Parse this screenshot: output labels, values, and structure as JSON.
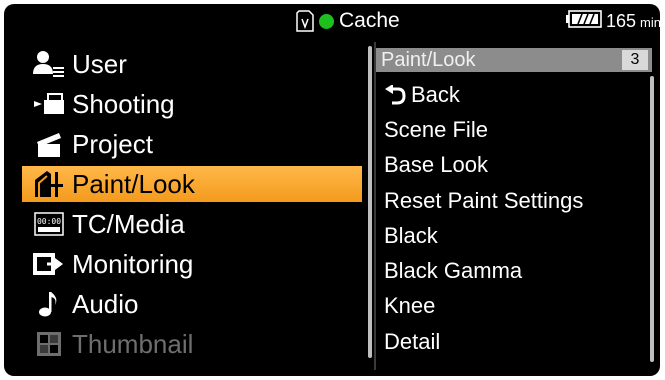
{
  "status": {
    "media_icon": "sd-card-icon",
    "cache_label": "Cache",
    "rec_indicator_color": "#1ec01e",
    "battery_time": "165",
    "battery_unit": "min"
  },
  "main_menu": {
    "items": [
      {
        "label": "User",
        "icon": "user-icon"
      },
      {
        "label": "Shooting",
        "icon": "camera-icon"
      },
      {
        "label": "Project",
        "icon": "clapperboard-icon"
      },
      {
        "label": "Paint/Look",
        "icon": "paint-look-icon",
        "selected": true
      },
      {
        "label": "TC/Media",
        "icon": "timecode-icon"
      },
      {
        "label": "Monitoring",
        "icon": "monitoring-icon"
      },
      {
        "label": "Audio",
        "icon": "music-note-icon"
      },
      {
        "label": "Thumbnail",
        "icon": "thumbnail-icon",
        "disabled": true
      }
    ],
    "selected_color": "#f5a623"
  },
  "submenu": {
    "title": "Paint/Look",
    "page": "3",
    "items": [
      {
        "label": "Back",
        "icon": "back-arrow-icon"
      },
      {
        "label": "Scene File"
      },
      {
        "label": "Base Look"
      },
      {
        "label": "Reset Paint Settings"
      },
      {
        "label": "Black"
      },
      {
        "label": "Black Gamma"
      },
      {
        "label": "Knee"
      },
      {
        "label": "Detail"
      }
    ]
  }
}
